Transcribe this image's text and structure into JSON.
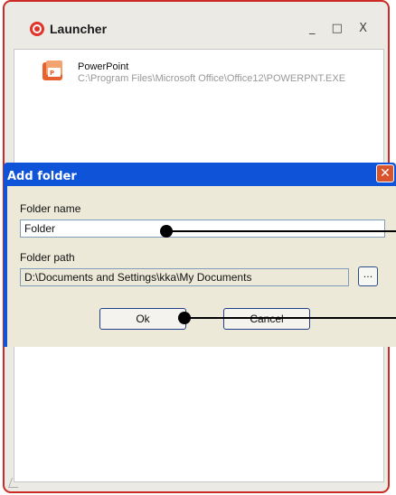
{
  "launcher": {
    "title": "Launcher",
    "controls": "_ □ X",
    "apps": [
      {
        "name": "PowerPoint",
        "path": "C:\\Program Files\\Microsoft Office\\Office12\\POWERPNT.EXE",
        "icon": "powerpoint-icon"
      }
    ]
  },
  "dialog": {
    "title": "Add folder",
    "close_label": "✕",
    "folder_name_label": "Folder name",
    "folder_name_value": "Folder",
    "folder_path_label": "Folder path",
    "folder_path_value": "D:\\Documents and Settings\\kka\\My Documents",
    "browse_label": "...",
    "ok_label": "Ok",
    "cancel_label": "Cancel"
  },
  "colors": {
    "accent": "#cc2a22",
    "dialog_title_bar": "#0f53d9",
    "dialog_body": "#ece9d8"
  }
}
